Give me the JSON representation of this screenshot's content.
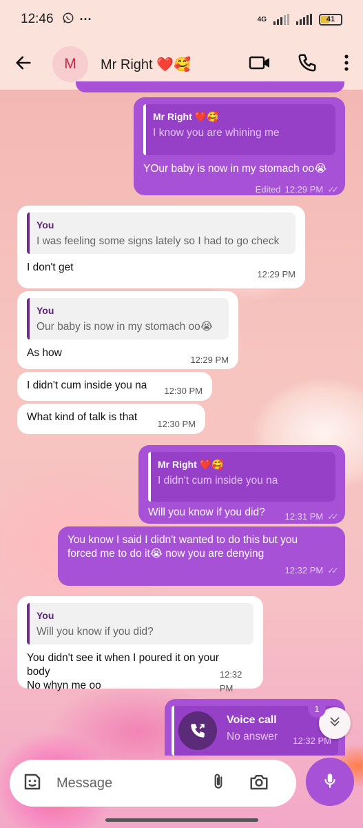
{
  "status_bar": {
    "time": "12:46",
    "network": "4G",
    "battery": "41",
    "dots": "···"
  },
  "header": {
    "avatar_letter": "M",
    "contact_name": "Mr Right ❤️🥰"
  },
  "messages": [
    {
      "direction": "out",
      "quote_name": "Mr Right ❤️🥰",
      "quote_text": "I know you are whining me",
      "text": "YOur baby is now in my stomach oo😭",
      "edited": "Edited",
      "time": "12:29 PM"
    },
    {
      "direction": "in",
      "quote_name": "You",
      "quote_text": "I was feeling some signs lately so I had to go check",
      "text": "I don't get",
      "time": "12:29 PM"
    },
    {
      "direction": "in",
      "quote_name": "You",
      "quote_text": "Our baby is now in my stomach oo😭",
      "text": "As how",
      "time": "12:29 PM"
    },
    {
      "direction": "in",
      "text": "I didn't cum inside you na",
      "time": "12:30 PM"
    },
    {
      "direction": "in",
      "text": "What kind of talk is that",
      "time": "12:30 PM"
    },
    {
      "direction": "out",
      "quote_name": "Mr Right ❤️🥰",
      "quote_text": "I didn't cum inside you na",
      "text": "Will you know if you did?",
      "time": "12:31 PM"
    },
    {
      "direction": "out",
      "text": "You know I said I didn't wanted to do this but you forced me to do it😭 now you are denying",
      "time": "12:32 PM"
    },
    {
      "direction": "in",
      "quote_name": "You",
      "quote_text": "Will you know if you did?",
      "text": "You didn't  see it when I poured it on your body\nNo whyn me oo",
      "time": "12:32 PM"
    },
    {
      "direction": "out",
      "call_title": "Voice call",
      "call_status": "No answer",
      "time": "12:32 PM"
    }
  ],
  "scroll": {
    "unread_count": "1"
  },
  "composer": {
    "placeholder": "Message"
  },
  "icons": [
    "back-arrow-icon",
    "video-call-icon",
    "phone-icon",
    "more-vert-icon",
    "sticker-icon",
    "attach-icon",
    "camera-icon",
    "mic-icon",
    "double-chevron-down-icon",
    "missed-call-icon",
    "whatsapp-icon"
  ],
  "colors": {
    "outgoing": "#a651d6",
    "incoming": "#ffffff",
    "header": "#fbe3dc",
    "accent": "#a651d6"
  }
}
